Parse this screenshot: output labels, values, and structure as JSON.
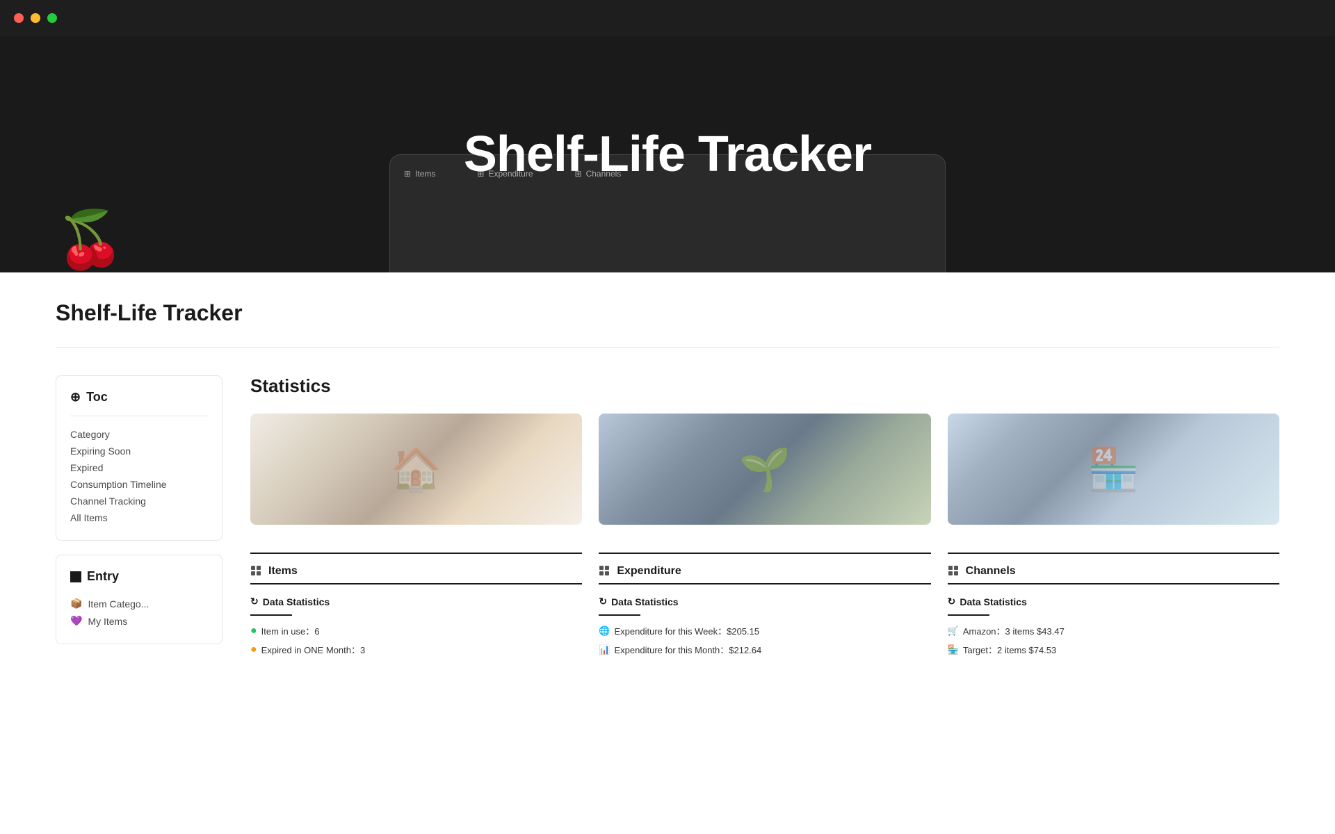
{
  "titlebar": {
    "lights": [
      "red",
      "yellow",
      "green"
    ]
  },
  "hero": {
    "title": "Shelf-Life Tracker",
    "mockup_tabs": [
      "Items",
      "Expenditure",
      "Channels"
    ]
  },
  "page": {
    "title": "Shelf-Life Tracker"
  },
  "sidebar": {
    "toc_title": "Toc",
    "toc_icon": "☰",
    "toc_items": [
      {
        "label": "Category"
      },
      {
        "label": "Expiring Soon"
      },
      {
        "label": "Expired"
      },
      {
        "label": "Consumption Timeline"
      },
      {
        "label": "Channel Tracking"
      },
      {
        "label": "All Items"
      }
    ],
    "entry_title": "Entry",
    "entry_icon": "■",
    "entry_items": [
      {
        "label": "Item Catego...",
        "emoji": "📦"
      },
      {
        "label": "My Items",
        "emoji": "💜"
      }
    ]
  },
  "content": {
    "statistics_title": "Statistics",
    "images": [
      {
        "alt": "Kitchen scene",
        "type": "kitchen"
      },
      {
        "alt": "Coins with plant",
        "type": "coins"
      },
      {
        "alt": "Store aisle",
        "type": "store"
      }
    ],
    "columns": [
      {
        "header": "Items",
        "icon": "grid",
        "data_stats_label": "Data Statistics",
        "stats": [
          {
            "dot": "green",
            "label": "Item in use：6"
          },
          {
            "dot": "orange",
            "label": "Expired in ONE Month：3"
          }
        ]
      },
      {
        "header": "Expenditure",
        "icon": "grid",
        "data_stats_label": "Data Statistics",
        "stats": [
          {
            "dot": "neutral",
            "label": "Expenditure for this Week：$205.15"
          },
          {
            "dot": "neutral",
            "label": "Expenditure for this Month：$212.64"
          }
        ]
      },
      {
        "header": "Channels",
        "icon": "grid",
        "data_stats_label": "Data Statistics",
        "stats": [
          {
            "dot": "orange",
            "label": "Amazon：3 items $43.47"
          },
          {
            "dot": "neutral",
            "label": "Target：2 items $74.53"
          }
        ]
      }
    ]
  }
}
